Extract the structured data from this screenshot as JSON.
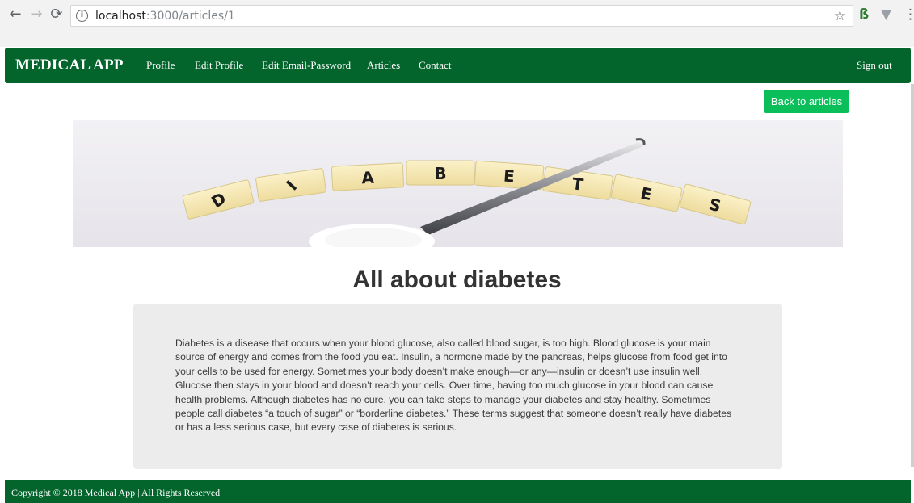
{
  "browser": {
    "url_host": "localhost",
    "url_path": ":3000/articles/1"
  },
  "navbar": {
    "brand": "MEDICAL APP",
    "links": [
      "Profile",
      "Edit Profile",
      "Edit Email-Password",
      "Articles",
      "Contact"
    ],
    "sign_out": "Sign out"
  },
  "page": {
    "back_button": "Back to articles"
  },
  "hero": {
    "letters": [
      "D",
      "I",
      "A",
      "B",
      "E",
      "T",
      "E",
      "S"
    ]
  },
  "article": {
    "title": "All about diabetes",
    "body": "Diabetes is a disease that occurs when your blood glucose, also called blood sugar, is too high. Blood glucose is your main source of energy and comes from the food you eat. Insulin, a hormone made by the pancreas, helps glucose from food get into your cells to be used for energy. Sometimes your body doesn’t make enough—or any—insulin or doesn’t use insulin well. Glucose then stays in your blood and doesn’t reach your cells. Over time, having too much glucose in your blood can cause health problems. Although diabetes has no cure, you can take steps to manage your diabetes and stay healthy. Sometimes people call diabetes “a touch of sugar” or “borderline diabetes.” These terms suggest that someone doesn’t really have diabetes or has a less serious case, but every case of diabetes is serious."
  },
  "footer": {
    "copyright": "Copyright © 2018 Medical App | All Rights Reserved"
  },
  "colors": {
    "navbar": "#03652c",
    "button": "#0abf5a",
    "article_bg": "#ececec"
  }
}
